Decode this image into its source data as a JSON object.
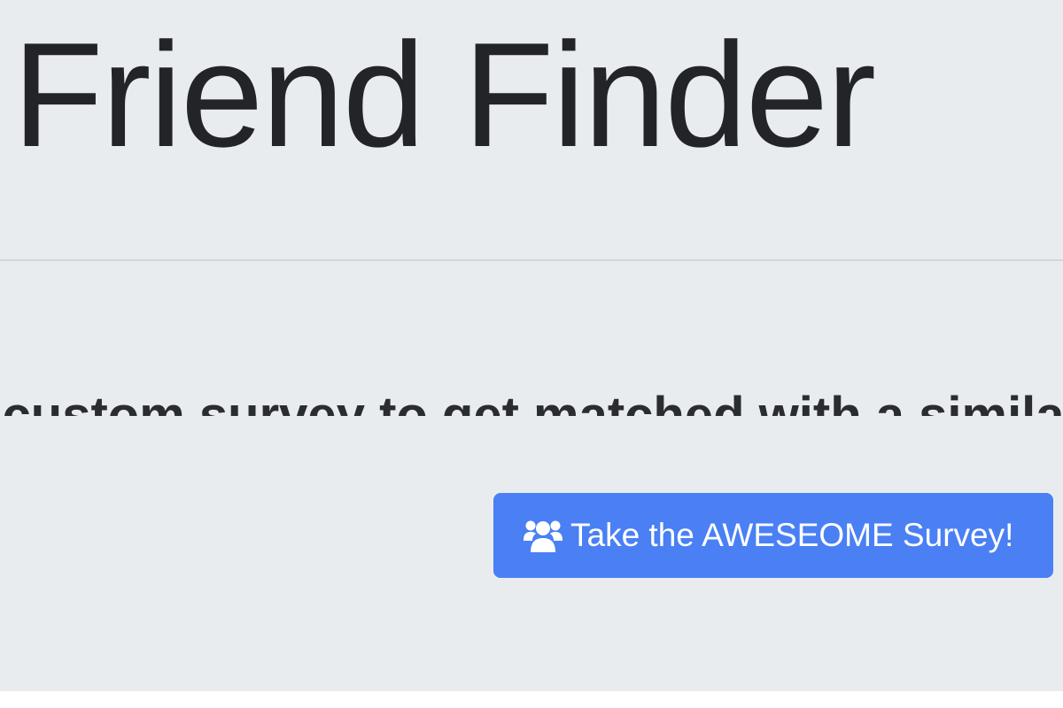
{
  "header": {
    "title": "Friend Finder"
  },
  "main": {
    "lead_text": "Take our custom survey to get matched with a similar friend!",
    "survey_button": {
      "label": "Take the AWESEOME Survey!",
      "icon": "users-icon"
    }
  },
  "colors": {
    "background": "#e9ecef",
    "button": "#4a80f4",
    "text": "#212529"
  }
}
